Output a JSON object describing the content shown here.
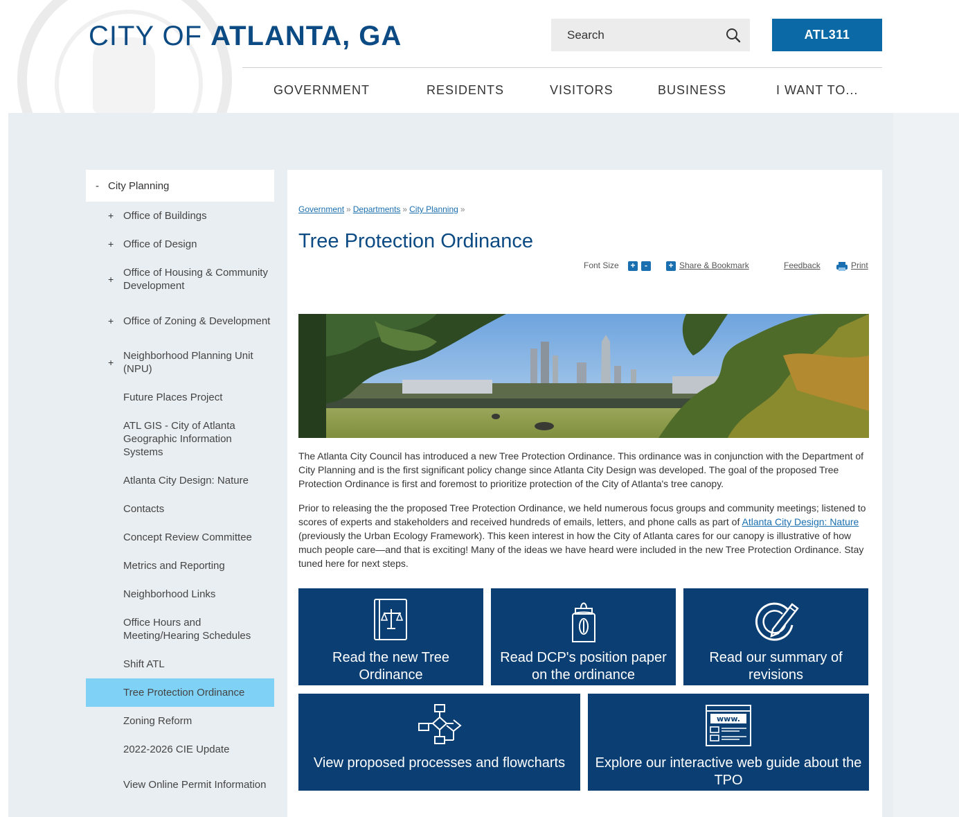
{
  "header": {
    "title_light": "CITY OF ",
    "title_bold": "ATLANTA, GA",
    "search_placeholder": "Search",
    "atl311_label": "ATL311",
    "nav": [
      "GOVERNMENT",
      "RESIDENTS",
      "VISITORS",
      "BUSINESS",
      "I WANT TO..."
    ]
  },
  "sidebar": {
    "head": {
      "toggle": "-",
      "label": "City Planning"
    },
    "items": [
      {
        "toggle": "+",
        "label": "Office of Buildings"
      },
      {
        "toggle": "+",
        "label": "Office of Design"
      },
      {
        "toggle": "+",
        "label": "Office of Housing & Community Development"
      },
      {
        "toggle": "+",
        "label": "Office of Zoning & Development"
      },
      {
        "toggle": "+",
        "label": "Neighborhood Planning Unit (NPU)"
      },
      {
        "toggle": "",
        "label": "Future Places Project"
      },
      {
        "toggle": "",
        "label": "ATL GIS - City of Atlanta Geographic Information Systems"
      },
      {
        "toggle": "",
        "label": "Atlanta City Design: Nature"
      },
      {
        "toggle": "",
        "label": "Contacts"
      },
      {
        "toggle": "",
        "label": "Concept Review Committee"
      },
      {
        "toggle": "",
        "label": "Metrics and Reporting"
      },
      {
        "toggle": "",
        "label": "Neighborhood Links"
      },
      {
        "toggle": "",
        "label": "Office Hours and Meeting/Hearing Schedules"
      },
      {
        "toggle": "",
        "label": "Shift ATL"
      },
      {
        "toggle": "",
        "label": "Tree Protection Ordinance"
      },
      {
        "toggle": "",
        "label": "Zoning Reform"
      },
      {
        "toggle": "",
        "label": "2022-2026 CIE Update"
      },
      {
        "toggle": "",
        "label": "View Online Permit Information"
      }
    ]
  },
  "content": {
    "breadcrumb": {
      "items": [
        "Government",
        "Departments",
        "City Planning"
      ],
      "sep": "»"
    },
    "title": "Tree Protection Ordinance",
    "tools": {
      "font_size": "Font Size",
      "increase": "+",
      "decrease": "-",
      "share": "Share & Bookmark",
      "feedback": "Feedback",
      "print": "Print"
    },
    "para1": "The Atlanta City Council has introduced a new Tree Protection Ordinance. This ordinance was in conjunction with the Department of City Planning and is the first significant policy change since Atlanta City Design was developed. The goal of the proposed Tree Protection Ordinance is first and foremost to prioritize protection of the City of Atlanta's tree canopy.",
    "para2_before": "Prior to releasing the the proposed Tree Protection Ordinance, we held numerous focus groups and community meetings; listened to scores of experts and stakeholders and received hundreds of emails, letters, and phone calls as part of ",
    "para2_link": "Atlanta City Design: Nature",
    "para2_after": " (previously the Urban Ecology Framework). This keen interest in how the City of Atlanta cares for our canopy is illustrative of how much people care—and that is exciting! Many of the ideas we have heard were included in the new Tree Protection Ordinance. Stay tuned here for next steps.",
    "tiles": [
      {
        "icon": "law-book-icon",
        "label": "Read the new Tree Ordinance"
      },
      {
        "icon": "position-paper-icon",
        "label": "Read DCP's position paper on the ordinance"
      },
      {
        "icon": "edit-revision-icon",
        "label": "Read our summary of revisions"
      },
      {
        "icon": "flowchart-icon",
        "label": "View proposed processes and flowcharts"
      },
      {
        "icon": "web-guide-icon",
        "label": "Explore our interactive web guide about the TPO"
      }
    ],
    "www_text": "www."
  }
}
